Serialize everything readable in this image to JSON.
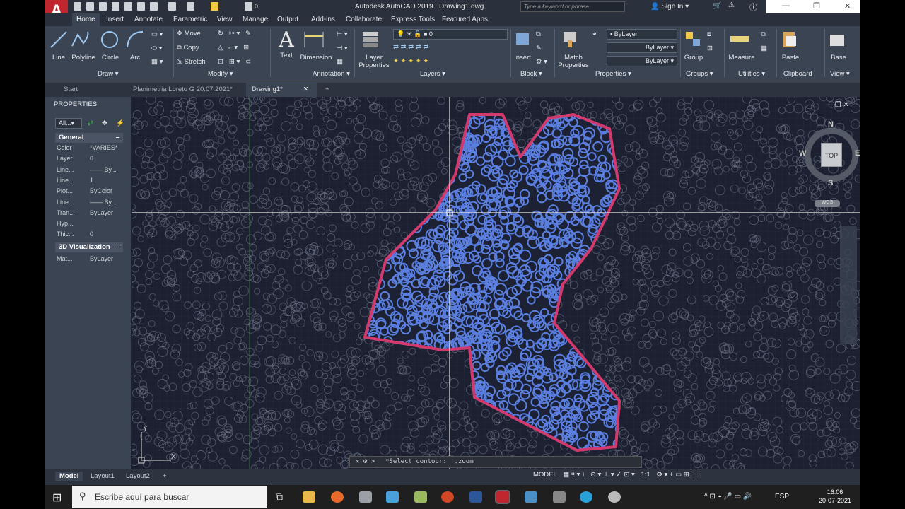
{
  "app": {
    "title": "Autodesk AutoCAD 2019",
    "file": "Drawing1.dwg",
    "logo": "A",
    "qat_layer": "0"
  },
  "search": {
    "placeholder": "Type a keyword or phrase"
  },
  "account": {
    "sign_in": "Sign In"
  },
  "ribbon_tabs": [
    "Home",
    "Insert",
    "Annotate",
    "Parametric",
    "View",
    "Manage",
    "Output",
    "Add-ins",
    "Collaborate",
    "Express Tools",
    "Featured Apps"
  ],
  "draw": {
    "line": "Line",
    "polyline": "Polyline",
    "circle": "Circle",
    "arc": "Arc",
    "group": "Draw"
  },
  "modify": {
    "move": "Move",
    "copy": "Copy",
    "stretch": "Stretch",
    "group": "Modify"
  },
  "annotation": {
    "text": "Text",
    "dimension": "Dimension",
    "group": "Annotation"
  },
  "layers": {
    "properties": "Layer Properties",
    "current": "0",
    "group": "Layers"
  },
  "block": {
    "insert": "Insert",
    "group": "Block"
  },
  "properties_panel": {
    "match": "Match Properties",
    "color": "ByLayer",
    "linetype": "ByLayer",
    "lineweight": "ByLayer",
    "group": "Properties"
  },
  "groups": {
    "group": "Group",
    "label": "Groups"
  },
  "utilities": {
    "measure": "Measure",
    "label": "Utilities"
  },
  "clipboard": {
    "paste": "Paste",
    "label": "Clipboard"
  },
  "view": {
    "base": "Base",
    "label": "View"
  },
  "doc_tabs": [
    "Start",
    "Planimetria Loreto G 20.07.2021*",
    "Drawing1*"
  ],
  "palette": {
    "title": "PROPERTIES",
    "selector": "All...",
    "general": "General",
    "rows": [
      {
        "k": "Color",
        "v": "*VARIES*"
      },
      {
        "k": "Layer",
        "v": "0"
      },
      {
        "k": "Line...",
        "v": "—— By..."
      },
      {
        "k": "Line...",
        "v": "1"
      },
      {
        "k": "Plot...",
        "v": "ByColor"
      },
      {
        "k": "Line...",
        "v": "—— By..."
      },
      {
        "k": "Tran...",
        "v": "ByLayer"
      },
      {
        "k": "Hyp...",
        "v": ""
      },
      {
        "k": "Thic...",
        "v": "0"
      }
    ],
    "viz": "3D Visualization",
    "mat_k": "Mat...",
    "mat_v": "ByLayer"
  },
  "viewcube": {
    "n": "N",
    "s": "S",
    "e": "E",
    "w": "W",
    "face": "TOP",
    "wcs": "WCS"
  },
  "command": {
    "text": "*Select contour: _.zoom"
  },
  "ucs": {
    "y": "Y",
    "x": "X"
  },
  "layout_tabs": [
    "Model",
    "Layout1",
    "Layout2"
  ],
  "status": {
    "model": "MODEL",
    "scale": "1:1"
  },
  "taskbar": {
    "search": "Escribe aquí para buscar",
    "lang": "ESP",
    "time": "16:06",
    "date": "20-07-2021"
  },
  "colors": {
    "outline": "#d23a6e",
    "circles_in": "#5b7fe0",
    "circles_out": "#7a8293",
    "grid": "#2a3350"
  }
}
